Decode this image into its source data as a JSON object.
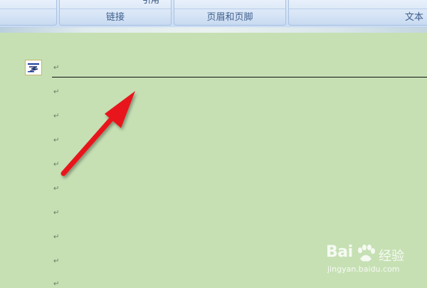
{
  "ribbon": {
    "groups": [
      {
        "label": "",
        "top_text": ""
      },
      {
        "label": "链接",
        "top_text": "引用"
      },
      {
        "label": "页眉和页脚",
        "top_text": ""
      },
      {
        "label": "文本",
        "top_text": ""
      }
    ]
  },
  "document": {
    "paragraph_mark": "↵",
    "icon": "header-footer-icon"
  },
  "overlay": {
    "arrow_color": "#e8141a",
    "arrow": "red-pointer-arrow"
  },
  "watermark": {
    "brand": "Bai",
    "paw": "paw-icon",
    "jingyan": "经验",
    "url": "jingyan.baidu.com"
  },
  "colors": {
    "page_background": "#c6e0b4",
    "ribbon": "#d7e5f6",
    "ribbon_text": "#3e5e8c"
  }
}
